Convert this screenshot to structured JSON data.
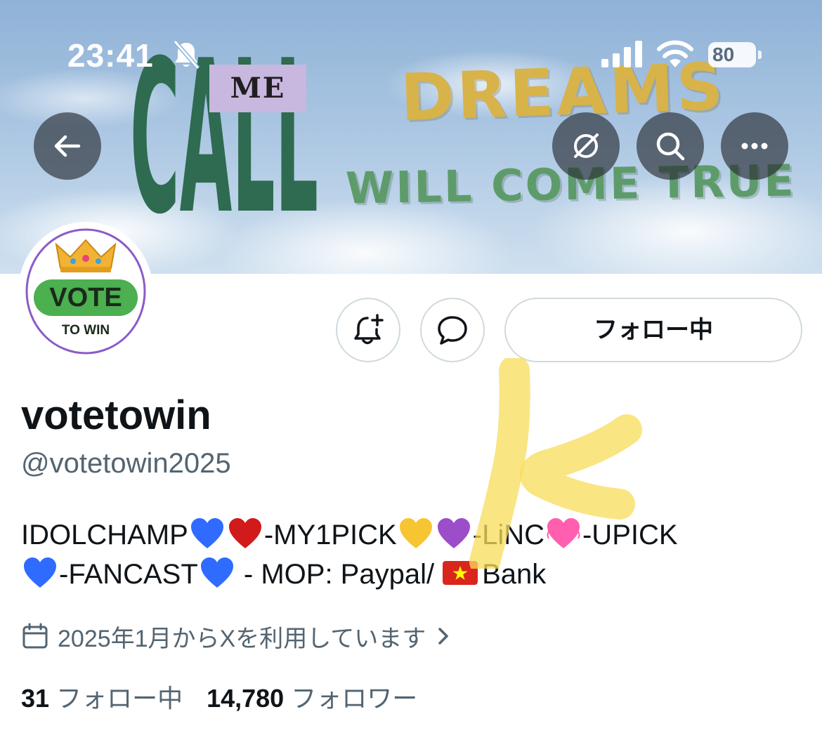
{
  "status_bar": {
    "time": "23:41",
    "battery": "80"
  },
  "banner": {
    "word_call": "CALL",
    "word_me": "ME",
    "word_dreams": "DREAMS",
    "word_will_come_true": "WILL COME TRUE"
  },
  "avatar": {
    "crown_icon": "crown-icon",
    "vote_text": "VOTE",
    "to_win_text": "TO WIN"
  },
  "actions": {
    "follow_label": "フォロー中"
  },
  "profile": {
    "display_name": "votetowin",
    "handle": "@votetowin2025",
    "bio": {
      "seg1": "IDOLCHAMP",
      "seg2": "-MY1PICK",
      "seg3": "-LiNC",
      "seg4": "-UPICK",
      "seg5": "-FANCAST",
      "seg6": " - MOP: Paypal/",
      "seg7": "Bank"
    },
    "joined": "2025年1月からXを利用しています"
  },
  "stats": {
    "following_count": "31",
    "following_label": "フォロー中",
    "followers_count": "14,780",
    "followers_label": "フォロワー"
  },
  "colors": {
    "text_primary": "#0f1419",
    "text_secondary": "#536471",
    "border": "#cfd9de",
    "vote_green": "#4caf50",
    "heart_blue": "#2f6bff",
    "heart_red": "#d11a1a",
    "heart_yellow": "#f7c531",
    "heart_purple": "#9b4dca",
    "heart_pink": "#ff5fae"
  }
}
